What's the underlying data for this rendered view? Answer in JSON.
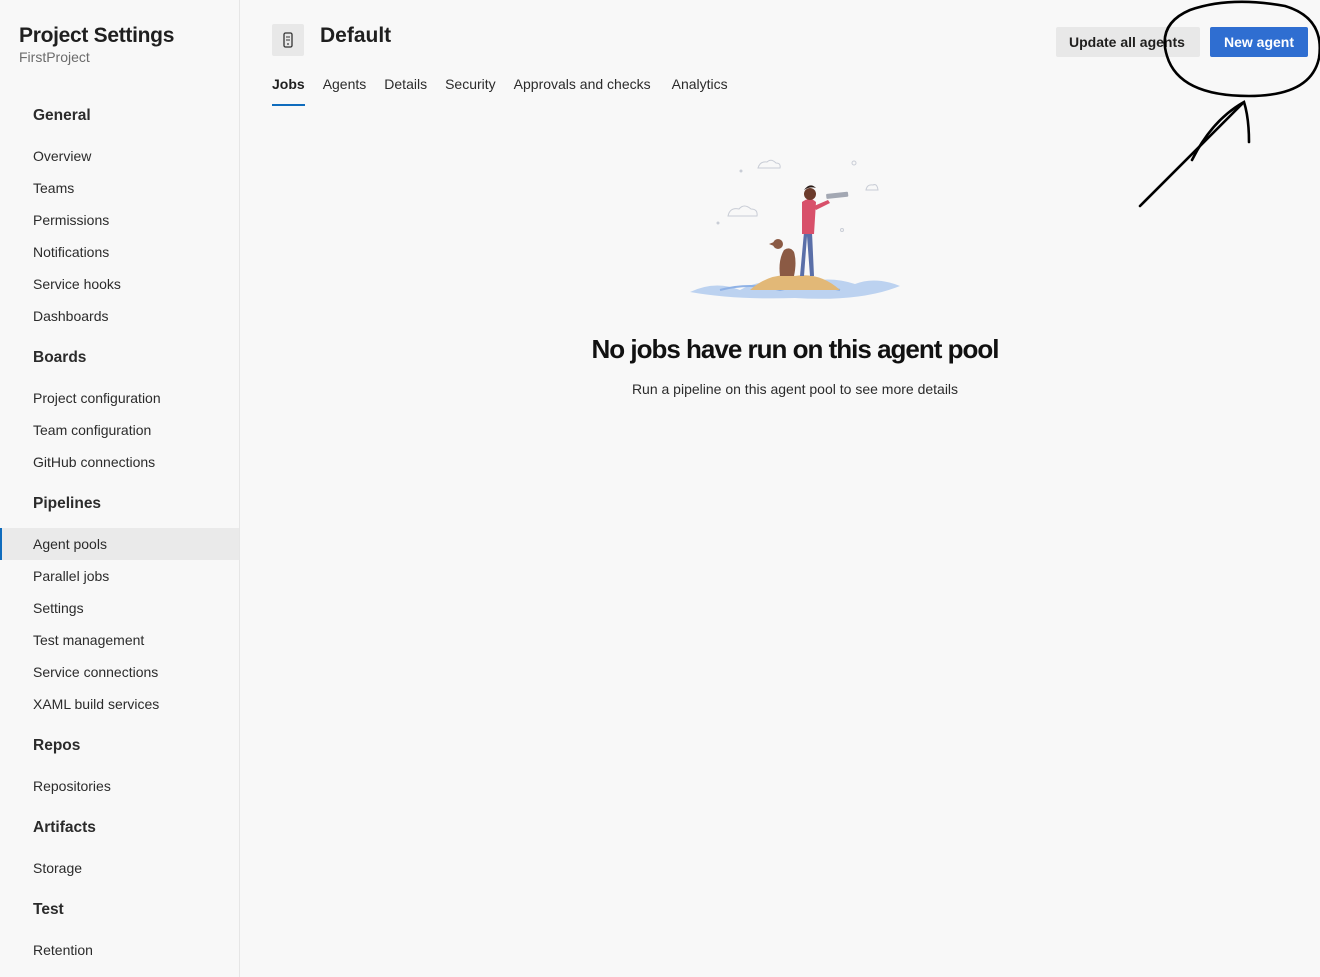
{
  "sidebar": {
    "title": "Project Settings",
    "project": "FirstProject",
    "sections": [
      {
        "header": "General",
        "items": [
          "Overview",
          "Teams",
          "Permissions",
          "Notifications",
          "Service hooks",
          "Dashboards"
        ]
      },
      {
        "header": "Boards",
        "items": [
          "Project configuration",
          "Team configuration",
          "GitHub connections"
        ]
      },
      {
        "header": "Pipelines",
        "items": [
          "Agent pools",
          "Parallel jobs",
          "Settings",
          "Test management",
          "Service connections",
          "XAML build services"
        ]
      },
      {
        "header": "Repos",
        "items": [
          "Repositories"
        ]
      },
      {
        "header": "Artifacts",
        "items": [
          "Storage"
        ]
      },
      {
        "header": "Test",
        "items": [
          "Retention"
        ]
      }
    ],
    "selected_item": "Agent pools"
  },
  "header": {
    "pool_icon": "agent-pool-icon",
    "title": "Default",
    "update_button": "Update all agents",
    "new_agent_button": "New agent"
  },
  "tabs": [
    "Jobs",
    "Agents",
    "Details",
    "Security",
    "Approvals and checks",
    "Analytics"
  ],
  "active_tab": "Jobs",
  "empty_state": {
    "title": "No jobs have run on this agent pool",
    "subtitle": "Run a pipeline on this agent pool to see more details",
    "illustration": "explorer-on-island-illustration"
  },
  "annotation": "hand-drawn-circle-and-arrow",
  "colors": {
    "primary": "#2f6ed1",
    "selected_indicator": "#0f6cbd",
    "background": "#f8f8f8"
  }
}
